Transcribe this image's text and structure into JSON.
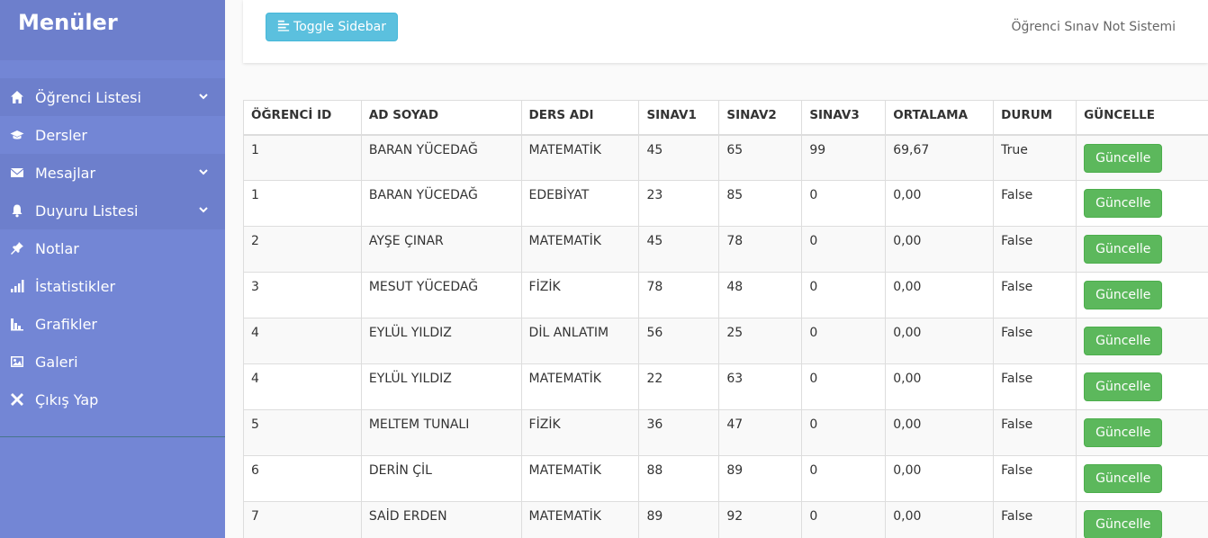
{
  "sidebar": {
    "title": "Menüler",
    "items": [
      {
        "label": "Öğrenci Listesi",
        "icon": "home-icon",
        "dark": true,
        "chevron": true
      },
      {
        "label": "Dersler",
        "icon": "graduation-cap-icon",
        "dark": false,
        "chevron": false
      },
      {
        "label": "Mesajlar",
        "icon": "envelope-icon",
        "dark": true,
        "chevron": true
      },
      {
        "label": "Duyuru Listesi",
        "icon": "bell-icon",
        "dark": true,
        "chevron": true
      },
      {
        "label": "Notlar",
        "icon": "pushpin-icon",
        "dark": false,
        "chevron": false
      },
      {
        "label": "İstatistikler",
        "icon": "signal-icon",
        "dark": false,
        "chevron": false
      },
      {
        "label": "Grafikler",
        "icon": "stats-icon",
        "dark": false,
        "chevron": false
      },
      {
        "label": "Galeri",
        "icon": "picture-icon",
        "dark": false,
        "chevron": false
      },
      {
        "label": "Çıkış Yap",
        "icon": "close-icon",
        "dark": false,
        "chevron": false
      }
    ]
  },
  "navbar": {
    "toggle_label": "Toggle Sidebar",
    "title": "Öğrenci Sınav Not Sistemi"
  },
  "table": {
    "headers": [
      "ÖĞRENCİ ID",
      "AD SOYAD",
      "DERS ADI",
      "SINAV1",
      "SINAV2",
      "SINAV3",
      "ORTALAMA",
      "DURUM",
      "GÜNCELLE"
    ],
    "rows": [
      [
        "1",
        "BARAN YÜCEDAĞ",
        "MATEMATİK",
        "45",
        "65",
        "99",
        "69,67",
        "True"
      ],
      [
        "1",
        "BARAN YÜCEDAĞ",
        "EDEBİYAT",
        "23",
        "85",
        "0",
        "0,00",
        "False"
      ],
      [
        "2",
        "AYŞE ÇINAR",
        "MATEMATİK",
        "45",
        "78",
        "0",
        "0,00",
        "False"
      ],
      [
        "3",
        "MESUT YÜCEDAĞ",
        "FİZİK",
        "78",
        "48",
        "0",
        "0,00",
        "False"
      ],
      [
        "4",
        "EYLÜL YILDIZ",
        "DİL ANLATIM",
        "56",
        "25",
        "0",
        "0,00",
        "False"
      ],
      [
        "4",
        "EYLÜL YILDIZ",
        "MATEMATİK",
        "22",
        "63",
        "0",
        "0,00",
        "False"
      ],
      [
        "5",
        "MELTEM TUNALI",
        "FİZİK",
        "36",
        "47",
        "0",
        "0,00",
        "False"
      ],
      [
        "6",
        "DERİN ÇİL",
        "MATEMATİK",
        "88",
        "89",
        "0",
        "0,00",
        "False"
      ],
      [
        "7",
        "SAİD ERDEN",
        "MATEMATİK",
        "89",
        "92",
        "0",
        "0,00",
        "False"
      ]
    ],
    "update_label": "Güncelle"
  },
  "colors": {
    "sidebar_bg": "#7386d5",
    "sidebar_dark": "#6d7fcc",
    "toggle_btn": "#5bc0de",
    "update_btn": "#5cb85c"
  }
}
